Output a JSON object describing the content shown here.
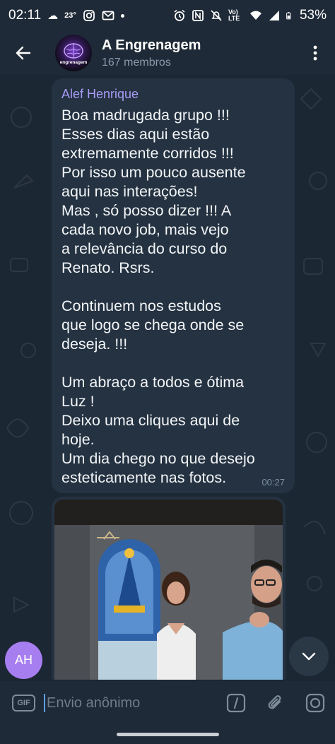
{
  "status_bar": {
    "time": "02:11",
    "temp": "23°",
    "network_label": "Vo) LTE",
    "battery": "53%"
  },
  "header": {
    "title": "A Engrenagem",
    "subtitle": "167 membros",
    "avatar_text": "engrenagem"
  },
  "message": {
    "sender": "Alef Henrique",
    "text": "Boa madrugada grupo !!!\nEsses dias aqui estão\nextremamente corridos !!!\nPor isso um pouco ausente\naqui nas interações!\nMas , só posso dizer !!! A\ncada novo job, mais vejo\na relevância do curso do\nRenato. Rsrs.\n\nContinuem nos estudos\nque logo se chega onde se\ndeseja. !!!\n\nUm abraço a todos e ótima\nLuz !\nDeixo uma cliques aqui de\nhoje.\nUm dia chego no que desejo\nesteticamente nas fotos.",
    "time": "00:27"
  },
  "sender_badge": "AH",
  "input": {
    "gif_label": "GIF",
    "placeholder": "Envio anônimo"
  },
  "colors": {
    "chat_bg": "#1c2734",
    "bubble": "#243241",
    "sender_name": "#a99bf5",
    "badge": "#a77ef0"
  }
}
